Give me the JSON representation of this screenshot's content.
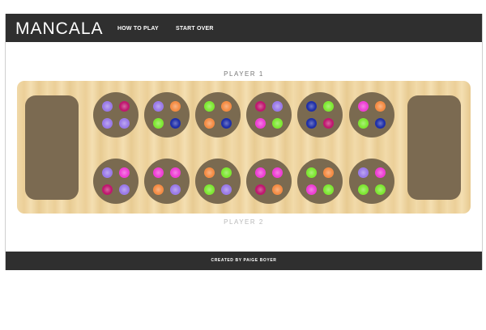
{
  "header": {
    "logo": "MANCALA",
    "nav": {
      "how_to_play": "HOW TO PLAY",
      "start_over": "START OVER"
    }
  },
  "players": {
    "player1_label": "PLAYER 1",
    "player2_label": "PLAYER 2"
  },
  "footer": {
    "credit": "CREATED BY PAIGE BOYER"
  },
  "colors": {
    "purple": "#9a7ae8",
    "magenta": "#c0176f",
    "green": "#7ee832",
    "orange": "#f58c44",
    "navy": "#1f2fa8",
    "pink": "#ee3fd4"
  },
  "board": {
    "top_row": [
      [
        "purple",
        "magenta",
        "purple",
        "purple"
      ],
      [
        "purple",
        "orange",
        "green",
        "navy"
      ],
      [
        "green",
        "orange",
        "orange",
        "navy"
      ],
      [
        "magenta",
        "purple",
        "pink",
        "green"
      ],
      [
        "navy",
        "green",
        "navy",
        "magenta"
      ],
      [
        "pink",
        "orange",
        "green",
        "navy"
      ]
    ],
    "bottom_row": [
      [
        "purple",
        "pink",
        "magenta",
        "purple"
      ],
      [
        "pink",
        "pink",
        "orange",
        "purple"
      ],
      [
        "orange",
        "green",
        "green",
        "purple"
      ],
      [
        "pink",
        "pink",
        "magenta",
        "orange"
      ],
      [
        "green",
        "orange",
        "pink",
        "green"
      ],
      [
        "purple",
        "pink",
        "green",
        "green"
      ]
    ]
  }
}
